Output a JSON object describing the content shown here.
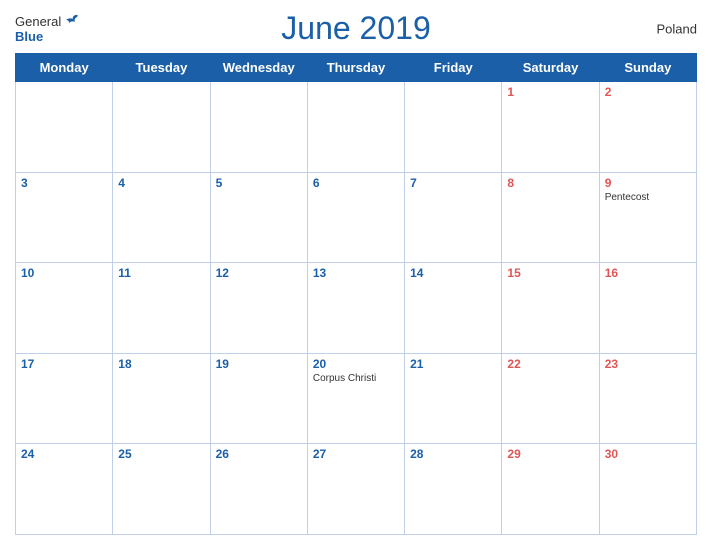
{
  "header": {
    "logo_general": "General",
    "logo_blue": "Blue",
    "title": "June 2019",
    "country": "Poland"
  },
  "days_of_week": [
    "Monday",
    "Tuesday",
    "Wednesday",
    "Thursday",
    "Friday",
    "Saturday",
    "Sunday"
  ],
  "weeks": [
    [
      {
        "day": "",
        "holiday": ""
      },
      {
        "day": "",
        "holiday": ""
      },
      {
        "day": "",
        "holiday": ""
      },
      {
        "day": "",
        "holiday": ""
      },
      {
        "day": "",
        "holiday": ""
      },
      {
        "day": "1",
        "holiday": ""
      },
      {
        "day": "2",
        "holiday": ""
      }
    ],
    [
      {
        "day": "3",
        "holiday": ""
      },
      {
        "day": "4",
        "holiday": ""
      },
      {
        "day": "5",
        "holiday": ""
      },
      {
        "day": "6",
        "holiday": ""
      },
      {
        "day": "7",
        "holiday": ""
      },
      {
        "day": "8",
        "holiday": ""
      },
      {
        "day": "9",
        "holiday": "Pentecost"
      }
    ],
    [
      {
        "day": "10",
        "holiday": ""
      },
      {
        "day": "11",
        "holiday": ""
      },
      {
        "day": "12",
        "holiday": ""
      },
      {
        "day": "13",
        "holiday": ""
      },
      {
        "day": "14",
        "holiday": ""
      },
      {
        "day": "15",
        "holiday": ""
      },
      {
        "day": "16",
        "holiday": ""
      }
    ],
    [
      {
        "day": "17",
        "holiday": ""
      },
      {
        "day": "18",
        "holiday": ""
      },
      {
        "day": "19",
        "holiday": ""
      },
      {
        "day": "20",
        "holiday": "Corpus Christi"
      },
      {
        "day": "21",
        "holiday": ""
      },
      {
        "day": "22",
        "holiday": ""
      },
      {
        "day": "23",
        "holiday": ""
      }
    ],
    [
      {
        "day": "24",
        "holiday": ""
      },
      {
        "day": "25",
        "holiday": ""
      },
      {
        "day": "26",
        "holiday": ""
      },
      {
        "day": "27",
        "holiday": ""
      },
      {
        "day": "28",
        "holiday": ""
      },
      {
        "day": "29",
        "holiday": ""
      },
      {
        "day": "30",
        "holiday": ""
      }
    ]
  ],
  "colors": {
    "header_bg": "#1a5fa8",
    "header_text": "#ffffff",
    "title": "#1a5fa8",
    "day_number": "#1a5fa8",
    "cell_border": "#c0cfe8"
  }
}
